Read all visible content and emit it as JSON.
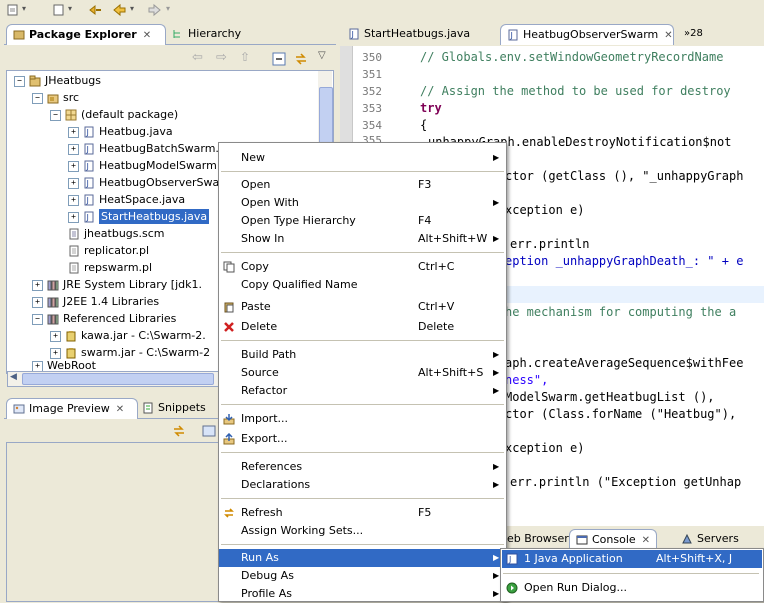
{
  "explorer": {
    "tabs": [
      {
        "label": "Package Explorer",
        "close": "✕"
      },
      {
        "label": "Hierarchy"
      }
    ],
    "tree": [
      {
        "label": "JHeatbugs"
      },
      {
        "label": "src"
      },
      {
        "label": "(default package)"
      },
      {
        "label": "Heatbug.java"
      },
      {
        "label": "HeatbugBatchSwarm."
      },
      {
        "label": "HeatbugModelSwarm."
      },
      {
        "label": "HeatbugObserverSwar"
      },
      {
        "label": "HeatSpace.java"
      },
      {
        "label": "StartHeatbugs.java"
      },
      {
        "label": "jheatbugs.scm"
      },
      {
        "label": "replicator.pl"
      },
      {
        "label": "repswarm.pl"
      },
      {
        "label": "JRE System Library [jdk1."
      },
      {
        "label": "J2EE 1.4 Libraries"
      },
      {
        "label": "Referenced Libraries"
      },
      {
        "label": "kawa.jar - C:\\Swarm-2."
      },
      {
        "label": "swarm.jar - C:\\Swarm-2"
      },
      {
        "label": "WebRoot"
      }
    ]
  },
  "bottom_left": {
    "tabs": [
      {
        "label": "Image Preview",
        "close": "✕"
      },
      {
        "label": "Snippets"
      }
    ]
  },
  "editor": {
    "tabs": [
      {
        "label": "StartHeatbugs.java"
      },
      {
        "label": "HeatbugObserverSwarm",
        "close": "✕"
      },
      {
        "label": "»28"
      }
    ],
    "lines": [
      {
        "num": "350",
        "text": "// Globals.env.setWindowGeometryRecordName"
      },
      {
        "num": "351",
        "text": ""
      },
      {
        "num": "352",
        "text": "// Assign the method to be used for destroy"
      },
      {
        "num": "353",
        "text": "try"
      },
      {
        "num": "354",
        "text": "{"
      },
      {
        "num": "355",
        "text": "unhappyGraph.enableDestroyNotification$not"
      }
    ],
    "fragments": [
      "ctor (getClass (), \"_unhappyGraph",
      "xception e)",
      "err.println",
      "eption _unhappyGraphDeath_: \" + e",
      "he mechanism for computing the a",
      "aph.createAverageSequence$withFee",
      "ness\",",
      "ModelSwarm.getHeatbugList (),",
      "ctor (Class.forName (\"Heatbug\"),",
      "xception e)",
      "err.println (\"Exception getUnhap"
    ]
  },
  "bottom_right": {
    "tabs": [
      {
        "label": "eb Browser"
      },
      {
        "label": "Console",
        "close": "✕"
      },
      {
        "label": "Servers"
      }
    ]
  },
  "context_menu": {
    "items": [
      {
        "label": "New",
        "accel": "",
        "submenu": true
      },
      {
        "label": "Open",
        "accel": "F3"
      },
      {
        "label": "Open With",
        "accel": "",
        "submenu": true
      },
      {
        "label": "Open Type Hierarchy",
        "accel": "F4"
      },
      {
        "label": "Show In",
        "accel": "Alt+Shift+W",
        "submenu": true
      },
      {
        "label": "Copy",
        "accel": "Ctrl+C"
      },
      {
        "label": "Copy Qualified Name",
        "accel": ""
      },
      {
        "label": "Paste",
        "accel": "Ctrl+V"
      },
      {
        "label": "Delete",
        "accel": "Delete"
      },
      {
        "label": "Build Path",
        "accel": "",
        "submenu": true
      },
      {
        "label": "Source",
        "accel": "Alt+Shift+S",
        "submenu": true
      },
      {
        "label": "Refactor",
        "accel": "",
        "submenu": true
      },
      {
        "label": "Import...",
        "accel": ""
      },
      {
        "label": "Export...",
        "accel": ""
      },
      {
        "label": "References",
        "accel": "",
        "submenu": true
      },
      {
        "label": "Declarations",
        "accel": "",
        "submenu": true
      },
      {
        "label": "Refresh",
        "accel": "F5"
      },
      {
        "label": "Assign Working Sets...",
        "accel": ""
      },
      {
        "label": "Run As",
        "accel": "",
        "submenu": true
      },
      {
        "label": "Debug As",
        "accel": "",
        "submenu": true
      },
      {
        "label": "Profile As",
        "accel": "",
        "submenu": true
      }
    ]
  },
  "run_as_submenu": {
    "items": [
      {
        "label": "1 Java Application",
        "accel": "Alt+Shift+X, J"
      },
      {
        "label": "Open Run Dialog..."
      }
    ]
  },
  "colors": {
    "selection": "#316ac5",
    "comment": "#3f7f5f",
    "keyword": "#7f0055",
    "string": "#2a00ff"
  }
}
